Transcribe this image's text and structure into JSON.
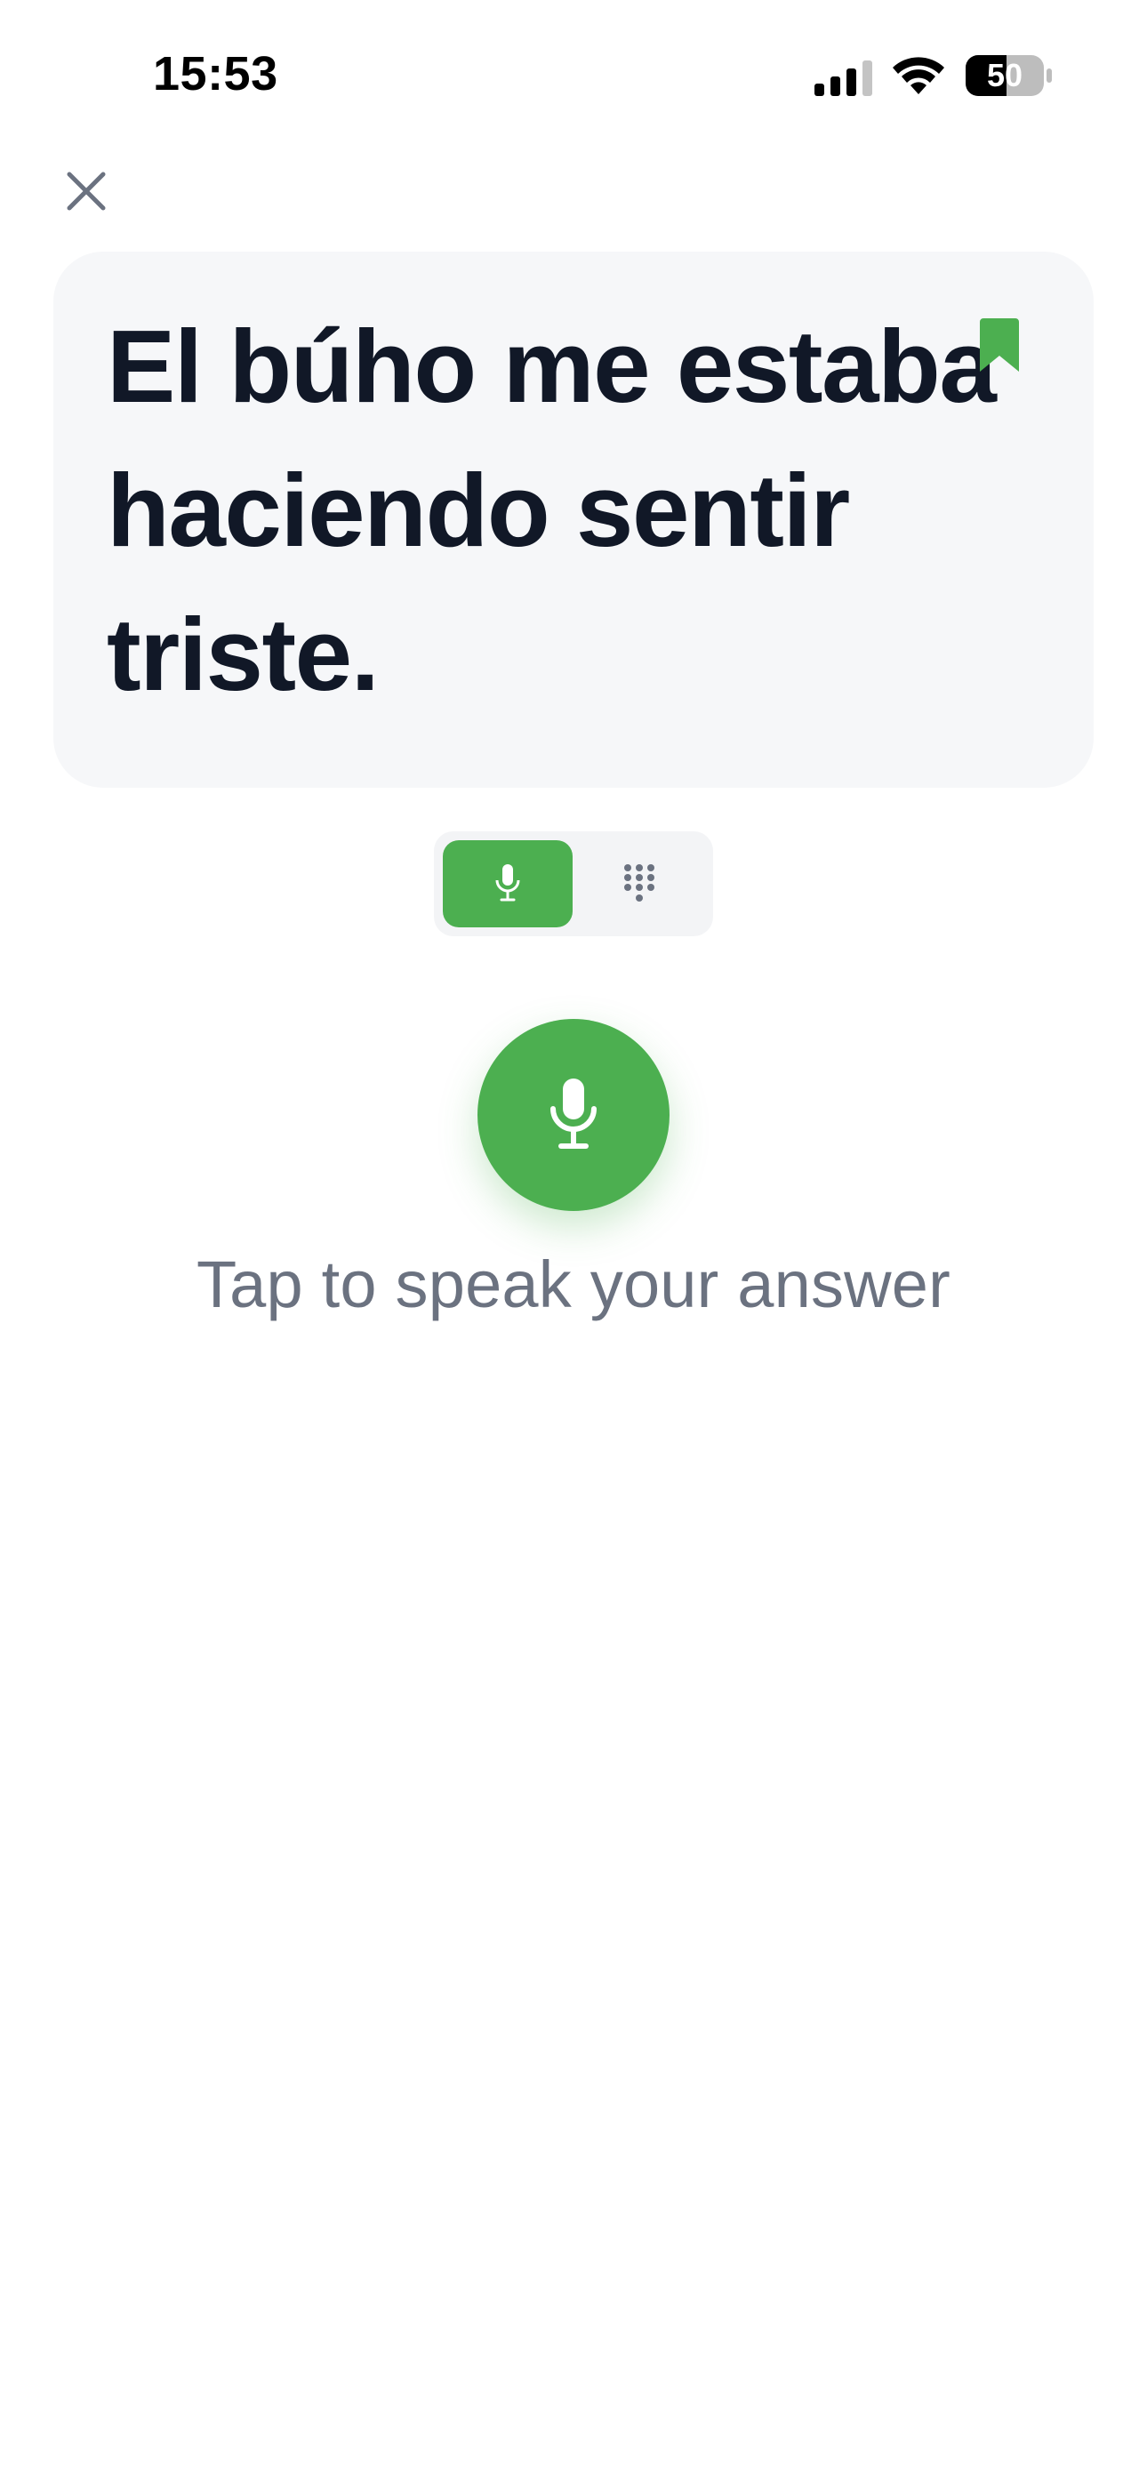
{
  "status_bar": {
    "time": "15:53",
    "battery": "50",
    "icons": [
      "signal-icon",
      "wifi-icon",
      "battery-icon"
    ]
  },
  "header": {
    "close_icon": "close-icon"
  },
  "phrase": {
    "text": "El búho me estaba haciendo sentir triste.",
    "bookmark_icon": "bookmark-icon"
  },
  "input_mode": {
    "options": [
      {
        "icon": "microphone-icon",
        "selected": true
      },
      {
        "icon": "keypad-icon",
        "selected": false
      }
    ]
  },
  "speak": {
    "icon": "microphone-icon",
    "hint": "Tap to speak your answer"
  },
  "colors": {
    "accent": "#4caf50",
    "text_primary": "#111827",
    "text_secondary": "#6b7280",
    "card_bg": "#f6f7f9",
    "toggle_bg": "#f3f4f6"
  }
}
